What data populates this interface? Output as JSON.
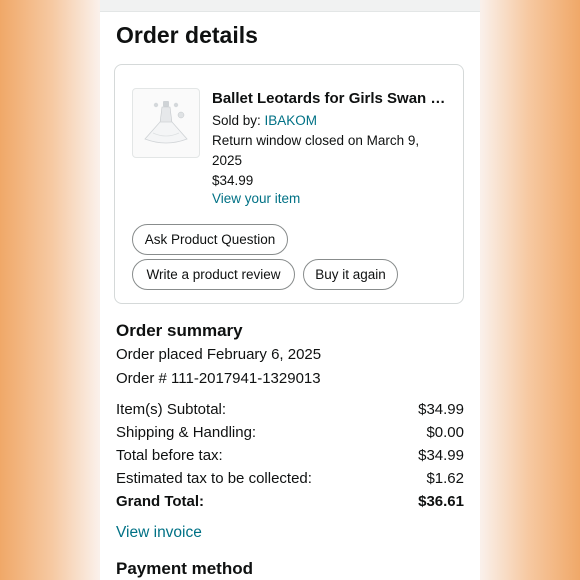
{
  "page": {
    "title": "Order details"
  },
  "item": {
    "name": "Ballet Leotards for Girls Swan Lake Tutu Dress",
    "sold_by_label": "Sold by:",
    "seller": "IBAKOM",
    "return_line1": "Return window closed on March 9,",
    "return_line2": "2025",
    "price": "$34.99",
    "view_item": "View your item",
    "image_icon": "tutu-dress-thumbnail"
  },
  "actions": {
    "ask_question": "Ask Product Question",
    "write_review": "Write a product review",
    "buy_again": "Buy it again"
  },
  "summary": {
    "title": "Order summary",
    "placed": "Order placed February 6, 2025",
    "order_number": "Order # 111-2017941-1329013",
    "rows": [
      {
        "label": "Item(s) Subtotal:",
        "value": "$34.99"
      },
      {
        "label": "Shipping & Handling:",
        "value": "$0.00"
      },
      {
        "label": "Total before tax:",
        "value": "$34.99"
      },
      {
        "label": "Estimated tax to be collected:",
        "value": "$1.62"
      }
    ],
    "grand_total": {
      "label": "Grand Total:",
      "value": "$36.61"
    },
    "view_invoice": "View invoice"
  },
  "payment": {
    "title": "Payment method"
  },
  "colors": {
    "link": "#007185",
    "text": "#0f1111",
    "border": "#d5d9d9"
  }
}
